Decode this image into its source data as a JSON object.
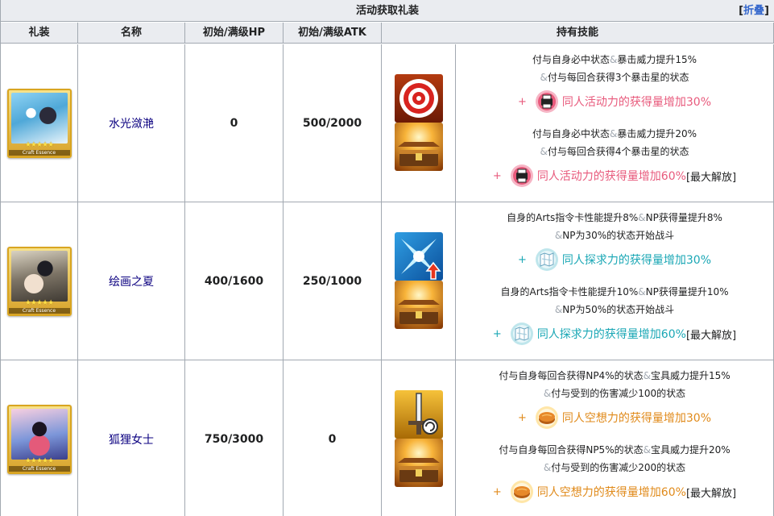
{
  "caption": {
    "title": "活动获取礼装",
    "collapse_open": "[",
    "collapse_label": "折叠",
    "collapse_close": "]"
  },
  "headers": [
    "礼装",
    "名称",
    "初始/满级HP",
    "初始/满级ATK",
    "持有技能"
  ],
  "colors": {
    "pink": "#e85a7c",
    "teal": "#1aa7b5",
    "orange": "#e08a1a",
    "link": "#0b0080",
    "border": "#a2a9b1",
    "header_bg": "#eaecf0"
  },
  "ce_card": {
    "stars": "★★★★★",
    "label": "Craft Essence"
  },
  "rows": [
    {
      "name": "水光潋滟",
      "hp": "0",
      "atk": "500/2000",
      "skill_icon": "critical-target-icon",
      "event_icon": "treasure-chest-icon",
      "base": {
        "l1": "付与自身必中状态",
        "l1b": "暴击威力提升15%",
        "l2b": "付与每回合获得3个暴击星的状态",
        "bonus": "同人活动力的获得量增加30%"
      },
      "max": {
        "l1": "付与自身必中状态",
        "l1b": "暴击威力提升20%",
        "l2b": "付与每回合获得4个暴击星的状态",
        "bonus": "同人活动力的获得量增加60%",
        "tag": "[最大解放]"
      },
      "bonus_icon": "printer-icon",
      "bonus_color": "#e85a7c"
    },
    {
      "name": "绘画之夏",
      "hp": "400/1600",
      "atk": "250/1000",
      "skill_icon": "arts-up-icon",
      "event_icon": "treasure-chest-icon",
      "base": {
        "l1": "自身的Arts指令卡性能提升8%",
        "l1b": "NP获得量提升8%",
        "l2b": "NP为30%的状态开始战斗",
        "bonus": "同人探求力的获得量增加30%"
      },
      "max": {
        "l1": "自身的Arts指令卡性能提升10%",
        "l1b": "NP获得量提升10%",
        "l2b": "NP为50%的状态开始战斗",
        "bonus": "同人探求力的获得量增加60%",
        "tag": "[最大解放]"
      },
      "bonus_icon": "map-icon",
      "bonus_color": "#1aa7b5"
    },
    {
      "name": "狐狸女士",
      "hp": "750/3000",
      "atk": "0",
      "skill_icon": "sword-np-icon",
      "event_icon": "treasure-chest-icon",
      "base": {
        "l1": "付与自身每回合获得NP4%的状态",
        "l1b": "宝具威力提升15%",
        "l2b": "付与受到的伤害减少100的状态",
        "bonus": "同人空想力的获得量增加30%"
      },
      "max": {
        "l1": "付与自身每回合获得NP5%的状态",
        "l1b": "宝具威力提升20%",
        "l2b": "付与受到的伤害减少200的状态",
        "bonus": "同人空想力的获得量增加60%",
        "tag": "[最大解放]"
      },
      "bonus_icon": "pie-icon",
      "bonus_color": "#e08a1a"
    }
  ],
  "symbols": {
    "amp": "&",
    "plus": "+"
  }
}
